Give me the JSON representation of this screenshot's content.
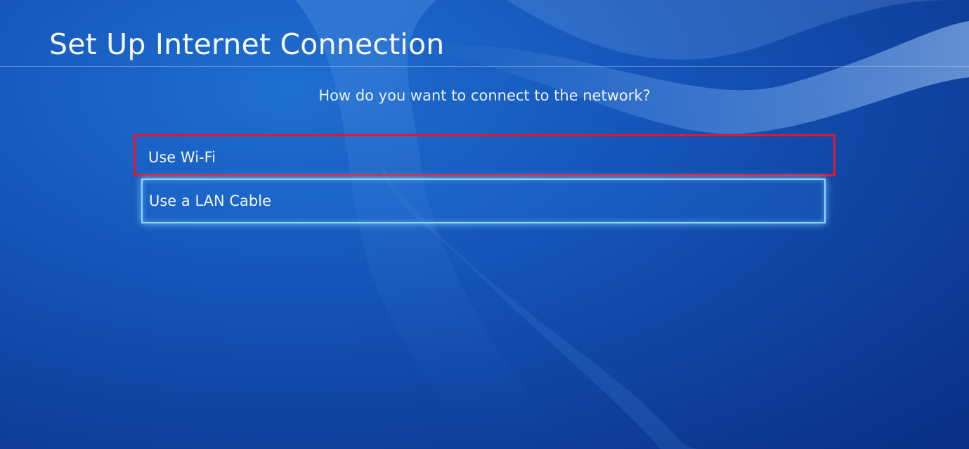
{
  "header": {
    "title": "Set Up Internet Connection"
  },
  "main": {
    "prompt": "How do you want to connect to the network?",
    "options": [
      {
        "label": "Use Wi-Fi",
        "highlighted": true
      },
      {
        "label": "Use a LAN Cable",
        "focused": true
      }
    ]
  },
  "colors": {
    "background": "#1553b8",
    "highlight_border": "#e0182d",
    "focus_glow": "#8fd6ff"
  }
}
